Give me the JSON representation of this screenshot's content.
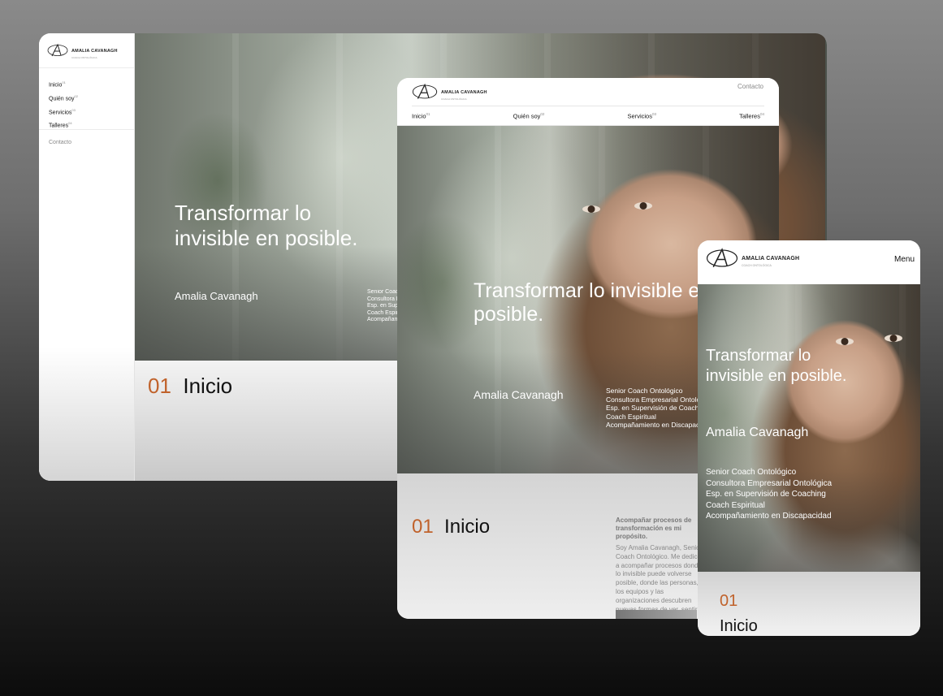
{
  "brand": {
    "name": "AMALIA CAVANAGH",
    "tagline": "COACH ONTOLÓGICA"
  },
  "nav": {
    "items": [
      {
        "label": "Inicio",
        "num": "01"
      },
      {
        "label": "Quién soy",
        "num": "02"
      },
      {
        "label": "Servicios",
        "num": "03"
      },
      {
        "label": "Talleres",
        "num": "04"
      }
    ],
    "contact": "Contacto",
    "menu": "Menu"
  },
  "hero": {
    "title": "Transformar lo invisible en posible.",
    "name": "Amalia Cavanagh",
    "roles": [
      "Senior Coach Ontológico",
      "Consultora Empresarial Ontológica",
      "Esp. en Supervisión de Coaching",
      "Coach Espiritual",
      "Acompañamiento en Discapacidad"
    ]
  },
  "section": {
    "num": "01",
    "title": "Inicio",
    "purpose": "Acompañar procesos de transformación es mi propósito.",
    "bio": "Soy Amalia Cavanagh, Senior Coach Ontológico. Me dedico a acompañar procesos donde lo invisible puede volverse posible, donde las personas, los equipos y las organizaciones descubren nuevas formas de ver, sentir y actuar."
  },
  "colors": {
    "accent": "#c0622b"
  }
}
